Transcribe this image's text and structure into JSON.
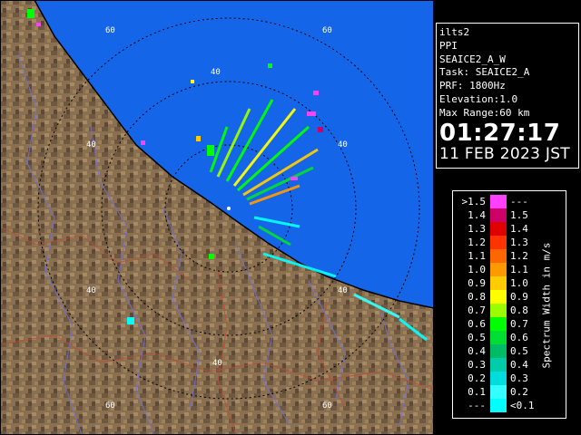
{
  "station": "ilts2",
  "scan_type": "PPI",
  "product": "SEAICE2_A_W",
  "task": "Task: SEAICE2_A",
  "prf": "PRF: 1800Hz",
  "elevation": "Elevation:1.0",
  "max_range": "Max Range:60 km",
  "time": "01:27:17",
  "date": "11 FEB 2023 JST",
  "legend": {
    "title": "Spectrum Width in m/s",
    "rows": [
      {
        "lo": ">1.5",
        "hi": "---",
        "color": "#ff40ff"
      },
      {
        "lo": "1.4",
        "hi": "1.5",
        "color": "#cc0066"
      },
      {
        "lo": "1.3",
        "hi": "1.4",
        "color": "#e00000"
      },
      {
        "lo": "1.2",
        "hi": "1.3",
        "color": "#ff3300"
      },
      {
        "lo": "1.1",
        "hi": "1.2",
        "color": "#ff6600"
      },
      {
        "lo": "1.0",
        "hi": "1.1",
        "color": "#ff9900"
      },
      {
        "lo": "0.9",
        "hi": "1.0",
        "color": "#ffcc00"
      },
      {
        "lo": "0.8",
        "hi": "0.9",
        "color": "#ffff00"
      },
      {
        "lo": "0.7",
        "hi": "0.8",
        "color": "#99ff00"
      },
      {
        "lo": "0.6",
        "hi": "0.7",
        "color": "#00ff00"
      },
      {
        "lo": "0.5",
        "hi": "0.6",
        "color": "#00dd33"
      },
      {
        "lo": "0.4",
        "hi": "0.5",
        "color": "#00bb66"
      },
      {
        "lo": "0.3",
        "hi": "0.4",
        "color": "#00ccaa"
      },
      {
        "lo": "0.2",
        "hi": "0.3",
        "color": "#00dddd"
      },
      {
        "lo": "0.1",
        "hi": "0.2",
        "color": "#33ffff"
      },
      {
        "lo": "---",
        "hi": "<0.1",
        "color": "#00ffff"
      }
    ]
  },
  "range_rings": {
    "labels": [
      "60",
      "60",
      "40",
      "40",
      "40",
      "40",
      "60"
    ]
  },
  "colors": {
    "sea": "#1565e8",
    "land": "#8a7050",
    "coast": "#000000",
    "rivers": "#6a6ad0",
    "borders": "#b04030",
    "rings": "#000000"
  }
}
